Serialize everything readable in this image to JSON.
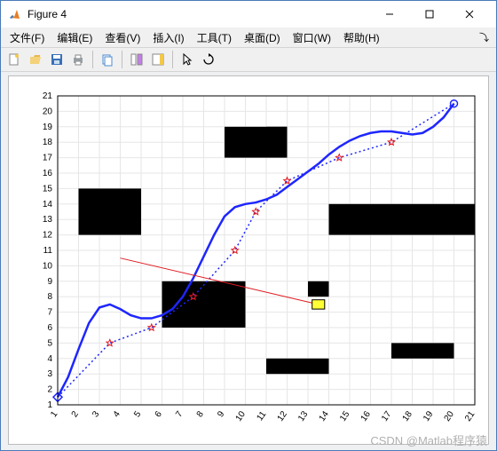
{
  "window": {
    "title": "Figure 4"
  },
  "menubar": {
    "file": "文件(F)",
    "edit": "编辑(E)",
    "view": "查看(V)",
    "insert": "插入(I)",
    "tools": "工具(T)",
    "desktop": "桌面(D)",
    "window": "窗口(W)",
    "help": "帮助(H)"
  },
  "toolbar": {
    "new": "新建",
    "open": "打开",
    "save": "保存",
    "print": "打印",
    "copy": "复制",
    "link": "链接",
    "colorbar": "色条",
    "pointer": "指针",
    "rotate": "旋转"
  },
  "watermark": "CSDN @Matlab程序猿",
  "chart_data": {
    "type": "line",
    "xlim": [
      1,
      21
    ],
    "ylim": [
      1,
      21
    ],
    "xticks": [
      1,
      2,
      3,
      4,
      5,
      6,
      7,
      8,
      9,
      10,
      11,
      12,
      13,
      14,
      15,
      16,
      17,
      18,
      19,
      20,
      21
    ],
    "yticks": [
      1,
      2,
      3,
      4,
      5,
      6,
      7,
      8,
      9,
      10,
      11,
      12,
      13,
      14,
      15,
      16,
      17,
      18,
      19,
      20,
      21
    ],
    "title": "",
    "xlabel": "",
    "ylabel": "",
    "obstacles_rects": [
      {
        "x": 2,
        "y": 12,
        "w": 3,
        "h": 3
      },
      {
        "x": 6,
        "y": 6,
        "w": 4,
        "h": 3
      },
      {
        "x": 9,
        "y": 17,
        "w": 3,
        "h": 2
      },
      {
        "x": 11,
        "y": 18,
        "w": 1,
        "h": 1
      },
      {
        "x": 14,
        "y": 12,
        "w": 7,
        "h": 2
      },
      {
        "x": 13,
        "y": 8,
        "w": 1,
        "h": 1
      },
      {
        "x": 17,
        "y": 4,
        "w": 3,
        "h": 1
      },
      {
        "x": 11,
        "y": 3,
        "w": 3,
        "h": 1
      }
    ],
    "start_marker": {
      "shape": "diamond",
      "x": 1,
      "y": 1.5,
      "color": "#1e26ff"
    },
    "goal_marker": {
      "shape": "circle",
      "x": 20,
      "y": 20.5,
      "color": "#1e26ff"
    },
    "series": [
      {
        "name": "smoothed-path",
        "style": "solid",
        "color": "#1e26ff",
        "width": 2.5,
        "values": [
          [
            1,
            1.5
          ],
          [
            1.5,
            2.8
          ],
          [
            2,
            4.6
          ],
          [
            2.5,
            6.3
          ],
          [
            3,
            7.3
          ],
          [
            3.5,
            7.5
          ],
          [
            4,
            7.2
          ],
          [
            4.5,
            6.8
          ],
          [
            5,
            6.6
          ],
          [
            5.5,
            6.6
          ],
          [
            6,
            6.8
          ],
          [
            6.5,
            7.2
          ],
          [
            7,
            8.0
          ],
          [
            7.5,
            9.2
          ],
          [
            8,
            10.6
          ],
          [
            8.5,
            12.0
          ],
          [
            9,
            13.2
          ],
          [
            9.5,
            13.8
          ],
          [
            10,
            14.0
          ],
          [
            10.5,
            14.1
          ],
          [
            11,
            14.3
          ],
          [
            11.5,
            14.6
          ],
          [
            12,
            15.1
          ],
          [
            12.5,
            15.6
          ],
          [
            13,
            16.1
          ],
          [
            13.5,
            16.6
          ],
          [
            14,
            17.2
          ],
          [
            14.5,
            17.7
          ],
          [
            15,
            18.1
          ],
          [
            15.5,
            18.4
          ],
          [
            16,
            18.6
          ],
          [
            16.5,
            18.7
          ],
          [
            17,
            18.7
          ],
          [
            17.5,
            18.6
          ],
          [
            18,
            18.5
          ],
          [
            18.5,
            18.6
          ],
          [
            19,
            19.0
          ],
          [
            19.5,
            19.6
          ],
          [
            20,
            20.5
          ]
        ]
      },
      {
        "name": "dotted-waypoints",
        "style": "dotted",
        "color": "#1e26ff",
        "width": 1.5,
        "values": [
          [
            1,
            1.5
          ],
          [
            3.5,
            5
          ],
          [
            5.5,
            6
          ],
          [
            7.5,
            8
          ],
          [
            9.5,
            11
          ],
          [
            10.5,
            13.5
          ],
          [
            12,
            15.5
          ],
          [
            14.5,
            17
          ],
          [
            17,
            18
          ],
          [
            20,
            20.5
          ]
        ]
      },
      {
        "name": "sight-line",
        "style": "solid",
        "color": "#e11920",
        "width": 1,
        "values": [
          [
            4,
            10.5
          ],
          [
            13.5,
            7.5
          ]
        ]
      }
    ],
    "star_waypoints": [
      [
        3.5,
        5
      ],
      [
        5.5,
        6
      ],
      [
        7.5,
        8
      ],
      [
        9.5,
        11
      ],
      [
        10.5,
        13.5
      ],
      [
        12,
        15.5
      ],
      [
        14.5,
        17
      ],
      [
        17,
        18
      ]
    ],
    "yellow_square": {
      "x": 13.5,
      "y": 7.5,
      "size": 0.6
    }
  }
}
